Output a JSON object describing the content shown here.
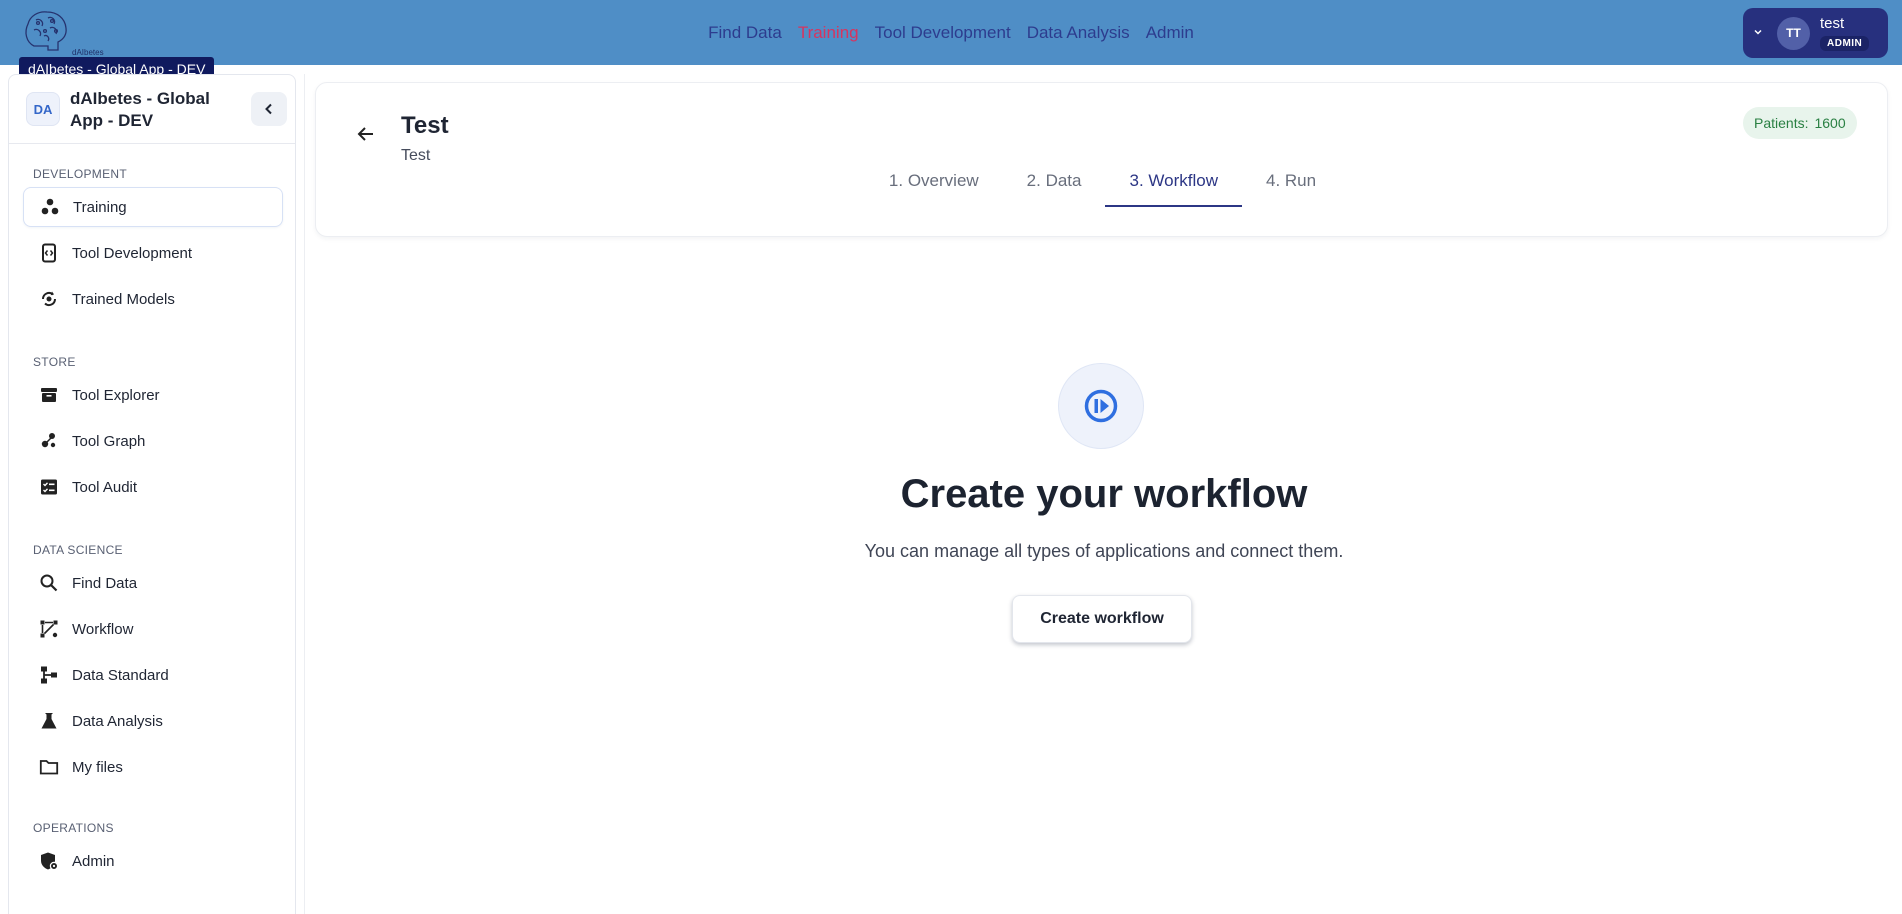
{
  "app": {
    "logo_text": "dAIbetes",
    "tooltip": "dAIbetes - Global App - DEV"
  },
  "topnav": [
    {
      "label": "Find Data",
      "active": false
    },
    {
      "label": "Training",
      "active": true
    },
    {
      "label": "Tool Development",
      "active": false
    },
    {
      "label": "Data Analysis",
      "active": false
    },
    {
      "label": "Admin",
      "active": false
    }
  ],
  "user": {
    "initials": "TT",
    "name": "test",
    "role": "ADMIN"
  },
  "sidebar": {
    "badge": "DA",
    "title": "dAIbetes - Global App - DEV",
    "sections": [
      {
        "label": "DEVELOPMENT",
        "items": [
          {
            "label": "Training",
            "icon": "molecule-icon",
            "active": true
          },
          {
            "label": "Tool Development",
            "icon": "code-phone-icon",
            "active": false
          },
          {
            "label": "Trained Models",
            "icon": "model-sync-icon",
            "active": false
          }
        ]
      },
      {
        "label": "STORE",
        "items": [
          {
            "label": "Tool Explorer",
            "icon": "archive-icon",
            "active": false
          },
          {
            "label": "Tool Graph",
            "icon": "graph-nodes-icon",
            "active": false
          },
          {
            "label": "Tool Audit",
            "icon": "checklist-icon",
            "active": false
          }
        ]
      },
      {
        "label": "DATA SCIENCE",
        "items": [
          {
            "label": "Find Data",
            "icon": "search-icon",
            "active": false
          },
          {
            "label": "Workflow",
            "icon": "workflow-icon",
            "active": false
          },
          {
            "label": "Data Standard",
            "icon": "hierarchy-icon",
            "active": false
          },
          {
            "label": "Data Analysis",
            "icon": "flask-icon",
            "active": false
          },
          {
            "label": "My files",
            "icon": "folder-icon",
            "active": false
          }
        ]
      },
      {
        "label": "OPERATIONS",
        "items": [
          {
            "label": "Admin",
            "icon": "admin-shield-icon",
            "active": false
          }
        ]
      }
    ]
  },
  "header": {
    "title": "Test",
    "subtitle": "Test",
    "patients_label": "Patients:",
    "patients_count": "1600",
    "tabs": [
      {
        "label": "1. Overview",
        "active": false
      },
      {
        "label": "2. Data",
        "active": false
      },
      {
        "label": "3. Workflow",
        "active": true
      },
      {
        "label": "4. Run",
        "active": false
      }
    ]
  },
  "empty_state": {
    "icon": "play-circle-icon",
    "title": "Create your workflow",
    "description": "You can manage all types of applications and connect them.",
    "button_label": "Create workflow"
  },
  "colors": {
    "topbar": "#4f8ec6",
    "nav_link": "#2d3c8e",
    "nav_active": "#d8345f",
    "user_pill": "#27307e",
    "accent": "#2f6fe0",
    "patients_bg": "#e8f4ec",
    "patients_text": "#2a8043"
  }
}
